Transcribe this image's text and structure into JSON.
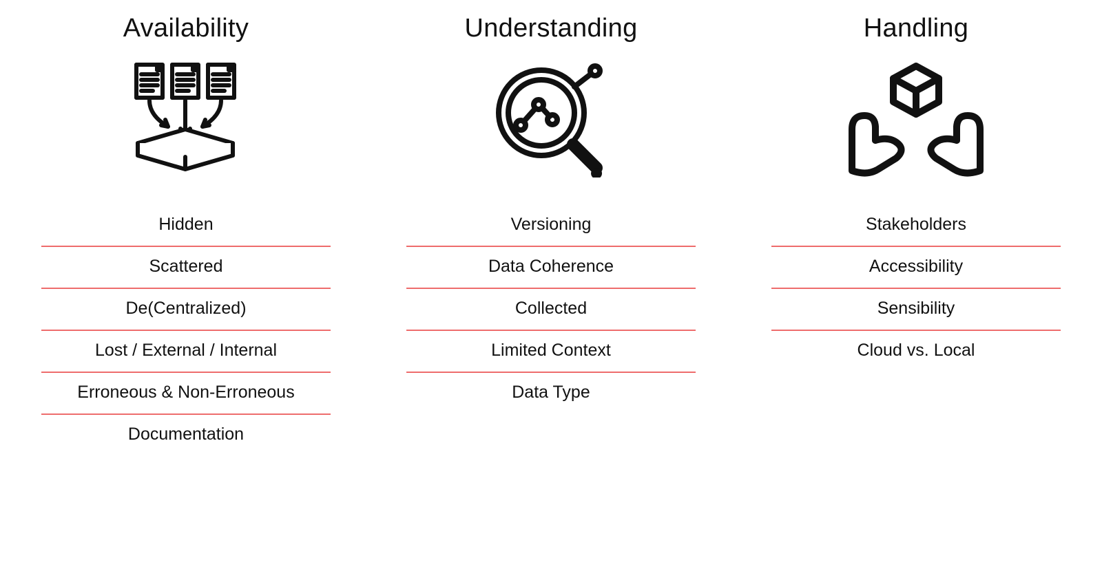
{
  "columns": [
    {
      "title": "Availability",
      "icon": "documents-into-box-icon",
      "items": [
        "Hidden",
        "Scattered",
        "De(Centralized)",
        "Lost / External / Internal",
        "Erroneous & Non-Erroneous",
        "Documentation"
      ]
    },
    {
      "title": "Understanding",
      "icon": "magnifier-chart-icon",
      "items": [
        "Versioning",
        "Data Coherence",
        "Collected",
        "Limited Context",
        "Data Type"
      ]
    },
    {
      "title": "Handling",
      "icon": "hands-holding-cube-icon",
      "items": [
        "Stakeholders",
        "Accessibility",
        "Sensibility",
        "Cloud vs. Local"
      ]
    }
  ],
  "styles": {
    "divider_color": "#ee6c6c",
    "text_color": "#111111",
    "background": "#ffffff"
  }
}
